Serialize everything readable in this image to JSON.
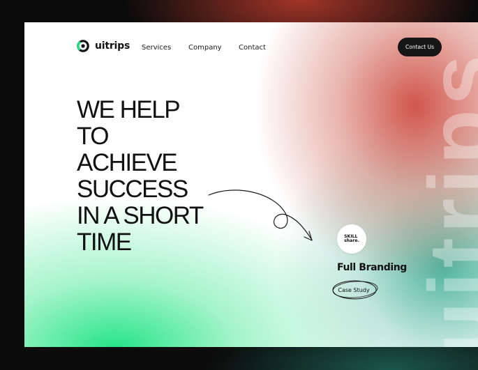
{
  "brand": {
    "name": "uitrips",
    "logo_icon": "ring-logo-icon"
  },
  "nav": {
    "items": [
      {
        "label": "Services"
      },
      {
        "label": "Company"
      },
      {
        "label": "Contact"
      }
    ],
    "cta_label": "Contact Us"
  },
  "hero": {
    "headline": "WE HELP\nTO\nACHIEVE\nSUCCESS\nIN A SHORT\nTIME",
    "arrow_icon": "curly-arrow-icon"
  },
  "showcase": {
    "badge_text": "SKILL\nshare.",
    "title": "Full Branding",
    "link_label": "Case Study"
  },
  "decor": {
    "background_text": "uitrips"
  },
  "colors": {
    "accent_green": "#18E280",
    "accent_red": "#CE4C42",
    "accent_teal": "#45AF98",
    "button_dark": "#161616",
    "text_dark": "#111111"
  }
}
